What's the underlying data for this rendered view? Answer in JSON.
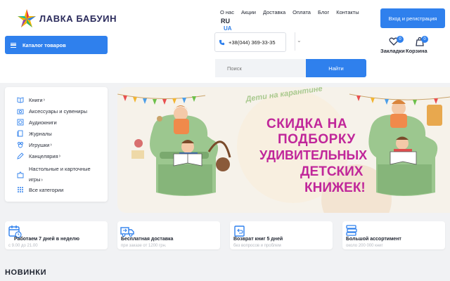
{
  "brand": {
    "name": "ЛАВКА БАБУИН"
  },
  "nav": {
    "items": [
      "О нас",
      "Акции",
      "Доставка",
      "Оплата",
      "Блог",
      "Контакты"
    ]
  },
  "language": {
    "current": "RU",
    "alternate": "UA"
  },
  "account": {
    "login_label": "Вход и регистрация"
  },
  "catalog": {
    "button_label": "Каталог товаров"
  },
  "phone": {
    "number": "+38(044) 369-33-35"
  },
  "search": {
    "placeholder": "Поиск",
    "button_label": "Найти"
  },
  "bookmarks": {
    "label": "Закладки",
    "count": "0"
  },
  "cart": {
    "label": "Корзина",
    "count": "0"
  },
  "categories": [
    {
      "label": "Книги",
      "has_children": true,
      "icon": "book-icon"
    },
    {
      "label": "Аксессуары и сувениры",
      "has_children": false,
      "icon": "camera-icon"
    },
    {
      "label": "Аудиокниги",
      "has_children": false,
      "icon": "disc-icon"
    },
    {
      "label": "Журналы",
      "has_children": false,
      "icon": "magazine-icon"
    },
    {
      "label": "Игрушки",
      "has_children": true,
      "icon": "toy-icon"
    },
    {
      "label": "Канцелярия",
      "has_children": true,
      "icon": "pencil-icon"
    },
    {
      "label": "Настольные и карточные игры",
      "has_children": true,
      "icon": "puzzle-icon"
    },
    {
      "label": "Все категории",
      "has_children": false,
      "icon": "grid-icon"
    }
  ],
  "banner": {
    "tag_line": "Дети на карантине",
    "headline": [
      "СКИДКА НА",
      "ПОДБОРКУ",
      "УДИВИТЕЛЬНЫХ",
      "ДЕТСКИХ",
      "КНИЖЕК!"
    ]
  },
  "features": [
    {
      "title": "Работаем 7 дней в неделю",
      "subtitle": "с 9.00 до 21.00",
      "icon": "calendar-icon"
    },
    {
      "title": "Бесплатная доставка",
      "subtitle": "при заказе от 1200 грн.",
      "icon": "truck-icon"
    },
    {
      "title": "Возврат книг 5 дней",
      "subtitle": "без вопросов и проблем",
      "icon": "return-box-icon"
    },
    {
      "title": "Большой ассортимент",
      "subtitle": "около 200 000 книг",
      "icon": "books-stack-icon"
    }
  ],
  "sections": {
    "new_title": "НОВИНКИ"
  },
  "colors": {
    "accent": "#2f80ed",
    "banner_text": "#c0269a",
    "banner_bg": "#f6f2ea"
  }
}
